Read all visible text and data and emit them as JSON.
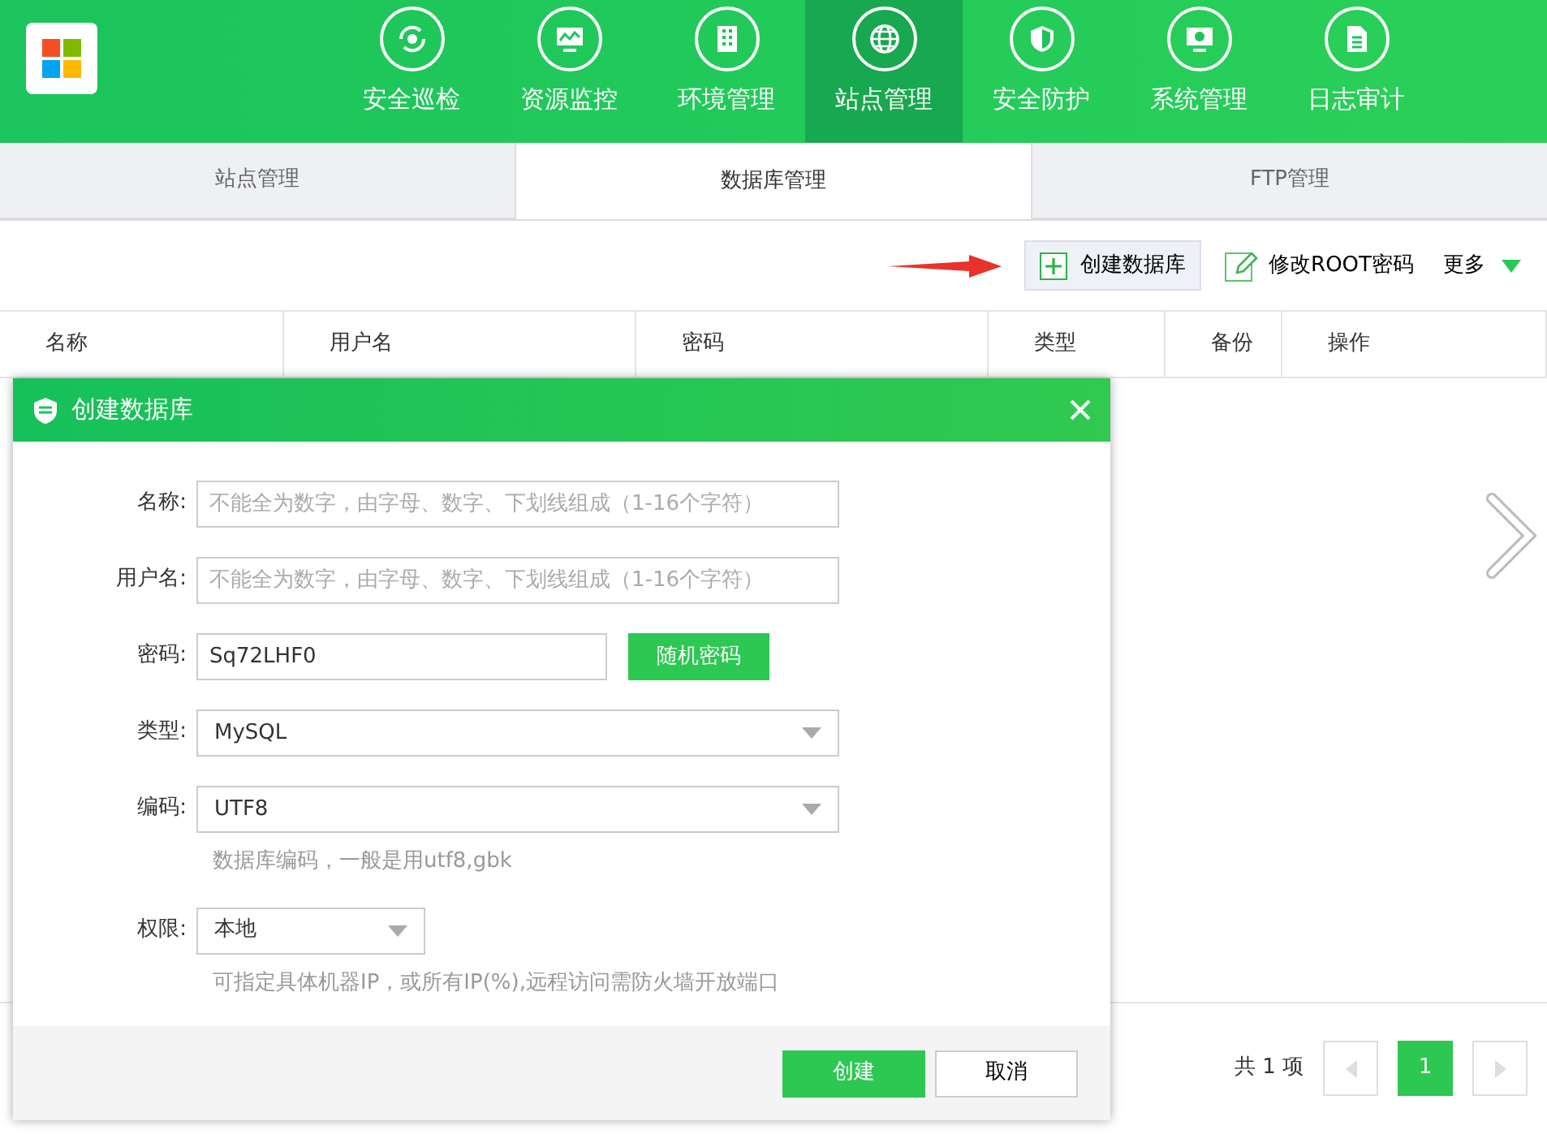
{
  "nav": {
    "items": [
      {
        "label": "安全巡检",
        "selected": false
      },
      {
        "label": "资源监控",
        "selected": false
      },
      {
        "label": "环境管理",
        "selected": false
      },
      {
        "label": "站点管理",
        "selected": true
      },
      {
        "label": "安全防护",
        "selected": false
      },
      {
        "label": "系统管理",
        "selected": false
      },
      {
        "label": "日志审计",
        "selected": false
      }
    ]
  },
  "tabs": [
    {
      "label": "站点管理",
      "selected": false
    },
    {
      "label": "数据库管理",
      "selected": true
    },
    {
      "label": "FTP管理",
      "selected": false
    }
  ],
  "toolbar": {
    "create": "创建数据库",
    "root": "修改ROOT密码",
    "more": "更多"
  },
  "table": {
    "columns": [
      "名称",
      "用户名",
      "密码",
      "类型",
      "备份",
      "操作"
    ]
  },
  "pagination": {
    "total": "共 1 项",
    "pages": [
      {
        "label": "1",
        "selected": true
      }
    ]
  },
  "dialog": {
    "title": "创建数据库",
    "fields": [
      {
        "kind": "input",
        "label": "名称:",
        "placeholder": "不能全为数字，由字母、数字、下划线组成（1-16个字符）"
      },
      {
        "kind": "input",
        "label": "用户名:",
        "placeholder": "不能全为数字，由字母、数字、下划线组成（1-16个字符）"
      },
      {
        "kind": "input-button",
        "label": "密码:",
        "value": "Sq72LHF0",
        "button": "随机密码"
      },
      {
        "kind": "select",
        "label": "类型:",
        "value": "MySQL"
      },
      {
        "kind": "select",
        "label": "编码:",
        "value": "UTF8",
        "hint": "数据库编码，一般是用utf8,gbk"
      },
      {
        "kind": "short-select",
        "label": "权限:",
        "value": "本地",
        "hint": "可指定具体机器IP，或所有IP(%),远程访问需防火墙开放端口"
      }
    ],
    "ok": "创建",
    "cancel": "取消"
  }
}
